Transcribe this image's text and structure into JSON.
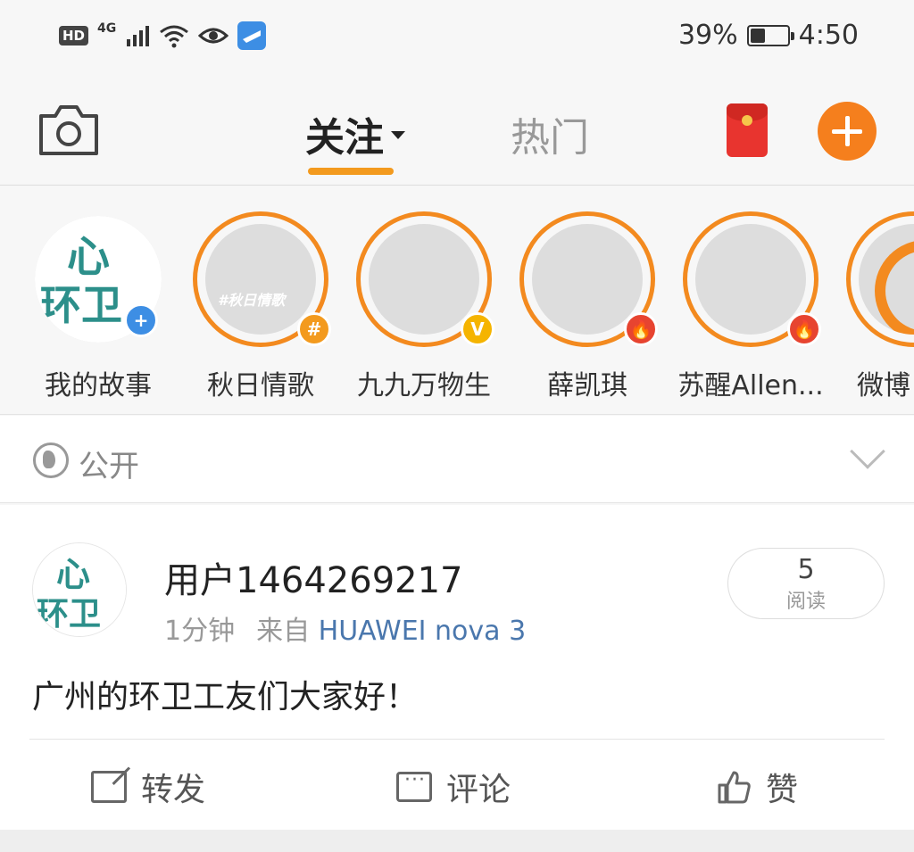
{
  "status_bar": {
    "hd": "HD",
    "network": "4G",
    "battery_percent": "39%",
    "time": "4:50",
    "battery_level": 0.39
  },
  "nav": {
    "tab_follow": "关注",
    "tab_hot": "热门",
    "icons": [
      "camera-icon",
      "red-packet-icon",
      "plus-icon"
    ],
    "accent_color": "#f57f1d"
  },
  "stories": [
    {
      "label": "我的故事",
      "badge": "plus",
      "logo": [
        "心",
        "环卫"
      ]
    },
    {
      "label": "秋日情歌",
      "badge": "#",
      "caption": "#秋日情歌"
    },
    {
      "label": "九九万物生",
      "badge": "V"
    },
    {
      "label": "薛凯琪",
      "badge": "fire"
    },
    {
      "label": "苏醒Allen...",
      "badge": "fire"
    },
    {
      "label": "微博"
    }
  ],
  "privacy": {
    "label": "公开"
  },
  "post": {
    "username": "用户1464269217",
    "time": "1分钟",
    "from_prefix": "来自",
    "source": "HUAWEI nova 3",
    "read_count": "5",
    "read_label": "阅读",
    "text": "广州的环卫工友们大家好！",
    "actions": {
      "forward": "转发",
      "comment": "评论",
      "like": "赞"
    }
  }
}
